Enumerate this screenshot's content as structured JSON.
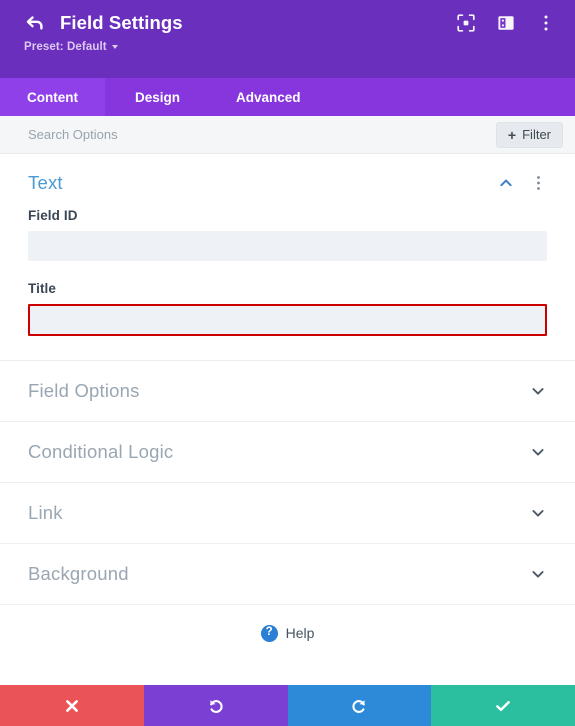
{
  "header": {
    "title": "Field Settings",
    "back_icon": "back-arrow-icon",
    "preset_label": "Preset: Default",
    "actions": [
      {
        "name": "focus-frame-icon",
        "label": "Focus"
      },
      {
        "name": "layout-panel-icon",
        "label": "Layout"
      },
      {
        "name": "more-options-icon",
        "label": "More Options"
      }
    ],
    "bg_color": "#6b2fbd"
  },
  "tabs": {
    "items": [
      {
        "label": "Content",
        "active": true
      },
      {
        "label": "Design",
        "active": false
      },
      {
        "label": "Advanced",
        "active": false
      }
    ],
    "bar_color": "#8636dc",
    "active_color": "#8f40e8"
  },
  "search": {
    "placeholder": "Search Options",
    "value": "",
    "filter_label": "Filter",
    "filter_plus": "+"
  },
  "open_section": {
    "title": "Text",
    "title_color": "#4a9ad4",
    "collapse_icon": "chevron-up-icon",
    "menu_icon": "more-options-icon",
    "fields": [
      {
        "label": "Field ID",
        "value": "",
        "placeholder": "",
        "highlighted": false
      },
      {
        "label": "Title",
        "value": "",
        "placeholder": "",
        "highlighted": true
      }
    ],
    "highlight_color": "#cc0000"
  },
  "accordions": [
    {
      "label": "Field Options",
      "icon": "chevron-down-icon"
    },
    {
      "label": "Conditional Logic",
      "icon": "chevron-down-icon"
    },
    {
      "label": "Link",
      "icon": "chevron-down-icon"
    },
    {
      "label": "Background",
      "icon": "chevron-down-icon"
    }
  ],
  "help": {
    "label": "Help",
    "icon_glyph": "?",
    "icon_color": "#2b7fd4"
  },
  "footer": {
    "buttons": [
      {
        "name": "cancel",
        "icon": "close-x-icon",
        "color": "#ea5458"
      },
      {
        "name": "undo",
        "icon": "undo-arrow-icon",
        "color": "#7b3fd4"
      },
      {
        "name": "redo",
        "icon": "redo-arrow-icon",
        "color": "#2d8ad8"
      },
      {
        "name": "save",
        "icon": "checkmark-icon",
        "color": "#2bbfa0"
      }
    ]
  }
}
